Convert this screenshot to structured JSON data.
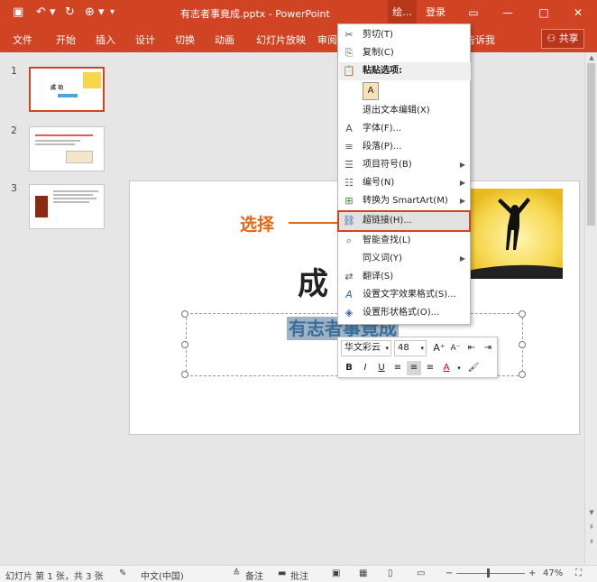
{
  "titlebar": {
    "title": "有志者事竟成.pptx - PowerPoint",
    "draw_tab": "绘...",
    "login": "登录"
  },
  "ribbon": {
    "tabs": [
      "文件",
      "开始",
      "插入",
      "设计",
      "切换",
      "动画",
      "幻灯片放映",
      "审阅",
      "告诉我"
    ],
    "share": "共享"
  },
  "thumbnails": {
    "numbers": [
      "1",
      "2",
      "3"
    ],
    "slide1_title": "成 功"
  },
  "slide": {
    "title_char": "成",
    "subtitle": "有志者事竟成"
  },
  "context_menu": {
    "items": [
      {
        "label": "剪切(T)",
        "icon": "scissors-icon"
      },
      {
        "label": "复制(C)",
        "icon": "copy-icon"
      },
      {
        "label": "粘贴选项:",
        "icon": "paste-icon"
      },
      {
        "label": "退出文本编辑(X)",
        "icon": ""
      },
      {
        "label": "字体(F)...",
        "icon": "font-icon"
      },
      {
        "label": "段落(P)...",
        "icon": "paragraph-icon"
      },
      {
        "label": "项目符号(B)",
        "icon": "bullets-icon"
      },
      {
        "label": "编号(N)",
        "icon": "numbering-icon"
      },
      {
        "label": "转换为 SmartArt(M)",
        "icon": "smartart-icon"
      },
      {
        "label": "超链接(H)...",
        "icon": "hyperlink-icon"
      },
      {
        "label": "智能查找(L)",
        "icon": "search-icon"
      },
      {
        "label": "同义词(Y)",
        "icon": ""
      },
      {
        "label": "翻译(S)",
        "icon": "translate-icon"
      },
      {
        "label": "设置文字效果格式(S)...",
        "icon": "text-effects-icon"
      },
      {
        "label": "设置形状格式(O)...",
        "icon": "shape-format-icon"
      }
    ]
  },
  "mini_toolbar": {
    "font_name": "华文彩云",
    "font_size": "48"
  },
  "annotation": {
    "text": "选择"
  },
  "statusbar": {
    "slide_info": "幻灯片 第 1 张，共 3 张",
    "language": "中文(中国)",
    "notes": "备注",
    "comments": "批注",
    "zoom": "47%"
  }
}
